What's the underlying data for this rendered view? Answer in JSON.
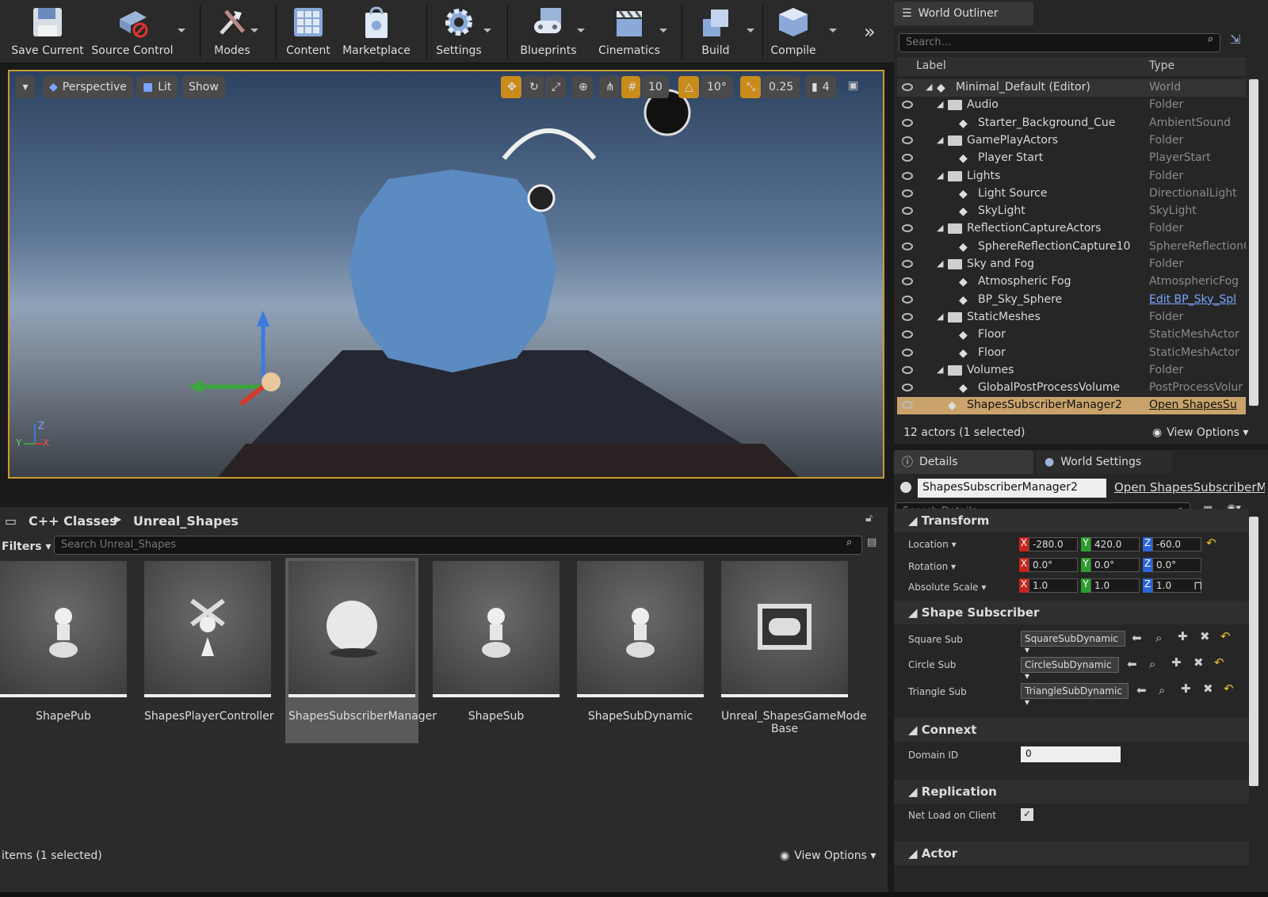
{
  "toolbar": {
    "save": "Save Current",
    "source": "Source Control",
    "modes": "Modes",
    "content": "Content",
    "marketplace": "Marketplace",
    "settings": "Settings",
    "blueprints": "Blueprints",
    "cinematics": "Cinematics",
    "build": "Build",
    "compile": "Compile"
  },
  "viewport": {
    "perspective": "Perspective",
    "lit": "Lit",
    "show": "Show",
    "grid": "10",
    "rot": "10°",
    "scale": "0.25",
    "speed": "4",
    "axis_z": "Z",
    "axis_y": "Y",
    "axis_x": "X"
  },
  "outliner": {
    "tab": "World Outliner",
    "search_ph": "Search...",
    "col_label": "Label",
    "col_type": "Type",
    "rows": [
      {
        "label": "Minimal_Default (Editor)",
        "type": "World"
      },
      {
        "label": "Audio",
        "type": "Folder"
      },
      {
        "label": "Starter_Background_Cue",
        "type": "AmbientSound"
      },
      {
        "label": "GamePlayActors",
        "type": "Folder"
      },
      {
        "label": "Player Start",
        "type": "PlayerStart"
      },
      {
        "label": "Lights",
        "type": "Folder"
      },
      {
        "label": "Light Source",
        "type": "DirectionalLight"
      },
      {
        "label": "SkyLight",
        "type": "SkyLight"
      },
      {
        "label": "ReflectionCaptureActors",
        "type": "Folder"
      },
      {
        "label": "SphereReflectionCapture10",
        "type": "SphereReflectionC"
      },
      {
        "label": "Sky and Fog",
        "type": "Folder"
      },
      {
        "label": "Atmospheric Fog",
        "type": "AtmosphericFog"
      },
      {
        "label": "BP_Sky_Sphere",
        "type": "Edit BP_Sky_Spl"
      },
      {
        "label": "StaticMeshes",
        "type": "Folder"
      },
      {
        "label": "Floor",
        "type": "StaticMeshActor"
      },
      {
        "label": "Floor",
        "type": "StaticMeshActor"
      },
      {
        "label": "Volumes",
        "type": "Folder"
      },
      {
        "label": "GlobalPostProcessVolume",
        "type": "PostProcessVolur"
      },
      {
        "label": "ShapesSubscriberManager2",
        "type": "Open ShapesSu"
      }
    ],
    "status": "12 actors (1 selected)",
    "view_options": "View Options"
  },
  "details": {
    "tab": "Details",
    "tab2": "World Settings",
    "name": "ShapesSubscriberManager2",
    "open_link": "Open ShapesSubscriberM",
    "search_ph": "Search Details",
    "transform": "Transform",
    "location": "Location",
    "rotation": "Rotation",
    "abs_scale": "Absolute Scale",
    "loc": [
      "-280.0",
      "420.0",
      "-60.0"
    ],
    "rot": [
      "0.0°",
      "0.0°",
      "0.0°"
    ],
    "scl": [
      "1.0",
      "1.0",
      "1.0"
    ],
    "shape_sub": "Shape Subscriber",
    "square_sub": "Square Sub",
    "circle_sub": "Circle Sub",
    "triangle_sub": "Triangle Sub",
    "square_val": "SquareSubDynamic",
    "circle_val": "CircleSubDynamic",
    "triangle_val": "TriangleSubDynamic",
    "connext": "Connext",
    "domain_id": "Domain ID",
    "domain_val": "0",
    "replication": "Replication",
    "net_load": "Net Load on Client",
    "actor": "Actor"
  },
  "browser": {
    "crumb1": "C++ Classes",
    "crumb2": "Unreal_Shapes",
    "filters": "Filters",
    "search_ph": "Search Unreal_Shapes",
    "tiles": [
      "ShapePub",
      "ShapesPlayerController",
      "ShapesSubscriberManager",
      "ShapeSub",
      "ShapeSubDynamic",
      "Unreal_ShapesGameMode Base"
    ],
    "status": "items (1 selected)",
    "view_options": "View Options"
  }
}
